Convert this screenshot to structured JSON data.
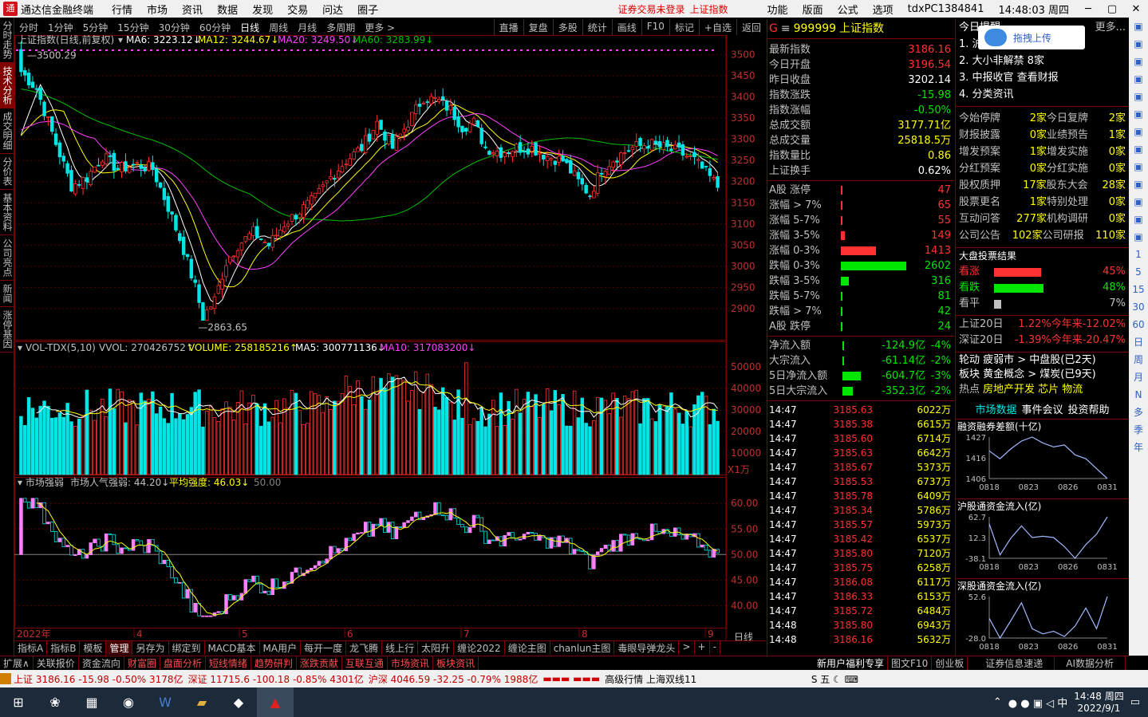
{
  "title_bar": {
    "app_name": "通达信金融终端",
    "menus": [
      "行情",
      "市场",
      "资讯",
      "数据",
      "发现",
      "交易",
      "问达",
      "圈子"
    ],
    "notice_login": "证券交易未登录",
    "notice_market": "上证指数",
    "right_menus": [
      "功能",
      "版面",
      "公式",
      "选项"
    ],
    "user": "tdxPC1384841",
    "time": "14:48:03 周四"
  },
  "left_tabs": [
    "分时走势",
    "技术分析",
    "成交明细",
    "分价表",
    "基本资料",
    "公司亮点",
    "新闻",
    "涨停基因"
  ],
  "chart_toolbar": {
    "periods": [
      "分时",
      "1分钟",
      "5分钟",
      "15分钟",
      "30分钟",
      "60分钟",
      "日线",
      "周线",
      "月线",
      "多周期",
      "更多 >"
    ],
    "active_period": "日线",
    "tools": [
      "直播",
      "复盘",
      "多股",
      "统计",
      "画线",
      "F10",
      "标记",
      "+自选",
      "返回"
    ]
  },
  "kline_header": {
    "name": "上证指数(日线,前复权)",
    "ma6": "MA6: 3223.12↓",
    "ma12": "MA12: 3244.67↓",
    "ma20": "MA20: 3249.50↓",
    "ma60": "MA60: 3283.99↓",
    "high_label": "3500.29",
    "low_label": "2863.65"
  },
  "vol_header": {
    "name": "VOL-TDX(5,10)",
    "vvol": "VVOL: 270426752↑",
    "volume": "VOLUME: 258185216↑",
    "ma5": "MA5: 300771136↓",
    "ma10": "MA10: 317083200↓",
    "unit": "X1万"
  },
  "sent_header": {
    "name": "市场强弱",
    "pop": "市场人气强弱: 44.20↓",
    "avg": "平均强度: 46.03↓",
    "ref": "50.00"
  },
  "axis": {
    "price_ticks": [
      "3500",
      "3450",
      "3400",
      "3350",
      "3300",
      "3250",
      "3200",
      "3150",
      "3100",
      "3050",
      "3000",
      "2950",
      "2900"
    ],
    "vol_ticks": [
      "50000",
      "40000",
      "30000",
      "20000",
      "10000"
    ],
    "sent_ticks": [
      "60.00",
      "55.00",
      "50.00",
      "45.00",
      "40.00"
    ],
    "x_labels": [
      "2022年",
      "4",
      "5",
      "6",
      "7",
      "8",
      "9"
    ],
    "period_label": "日线"
  },
  "colors": {
    "up": "#ff3232",
    "down": "#00e5e5",
    "ma6": "#ffffff",
    "ma12": "#ffff00",
    "ma20": "#ff40ff",
    "ma60": "#00c000",
    "frame": "#800000"
  },
  "bottom_tabs": [
    "指标A",
    "指标B",
    "模板",
    "管理",
    "另存为",
    "绑定到",
    "MACD基本",
    "MA用户",
    "每开一度",
    "龙飞腾",
    "线上行",
    "太阳升",
    "缠论2022",
    "缠论主图",
    "chanlun主图",
    "毒眼导弹龙头",
    ">",
    "+",
    "-"
  ],
  "bar2": [
    "扩展∧",
    "关联报价",
    "资金流向",
    "财富圈",
    "盘面分析",
    "短线情绪",
    "趋势研判",
    "涨跌贡献",
    "互联互通",
    "市场资讯",
    "板块资讯",
    "新用户福利专享",
    "图文F10",
    "创业板"
  ],
  "quote_panel": {
    "code": "999999",
    "name": "上证指数",
    "rows": [
      {
        "label": "最新指数",
        "value": "3186.16",
        "c": "red"
      },
      {
        "label": "今日开盘",
        "value": "3196.54",
        "c": "red"
      },
      {
        "label": "昨日收盘",
        "value": "3202.14",
        "c": "white"
      },
      {
        "label": "指数涨跌",
        "value": "-15.98",
        "c": "green"
      },
      {
        "label": "指数涨幅",
        "value": "-0.50%",
        "c": "green"
      },
      {
        "label": "总成交额",
        "value": "3177.71亿",
        "c": "yellow"
      },
      {
        "label": "总成交量",
        "value": "25818.5万",
        "c": "yellow"
      },
      {
        "label": "指数量比",
        "value": "0.86",
        "c": "yellow"
      },
      {
        "label": "上证换手",
        "value": "0.62%",
        "c": "white"
      }
    ],
    "breadth": [
      {
        "label": "A股 涨停",
        "value": "47",
        "c": "red",
        "bar": 0.02
      },
      {
        "label": "涨幅 > 7%",
        "value": "65",
        "c": "red",
        "bar": 0.03
      },
      {
        "label": "涨幅 5-7%",
        "value": "55",
        "c": "red",
        "bar": 0.02
      },
      {
        "label": "涨幅 3-5%",
        "value": "149",
        "c": "red",
        "bar": 0.06
      },
      {
        "label": "涨幅 0-3%",
        "value": "1413",
        "c": "red",
        "bar": 0.54
      },
      {
        "label": "跌幅 0-3%",
        "value": "2602",
        "c": "green",
        "bar": 1.0
      },
      {
        "label": "跌幅 3-5%",
        "value": "316",
        "c": "green",
        "bar": 0.12
      },
      {
        "label": "跌幅 5-7%",
        "value": "81",
        "c": "green",
        "bar": 0.03
      },
      {
        "label": "跌幅 > 7%",
        "value": "42",
        "c": "green",
        "bar": 0.02
      },
      {
        "label": "A股 跌停",
        "value": "24",
        "c": "green",
        "bar": 0.01
      }
    ],
    "flows": [
      {
        "label": "净流入额",
        "value": "-124.9亿",
        "pct": "-4%",
        "bar": 0.05
      },
      {
        "label": "大宗流入",
        "value": "-61.14亿",
        "pct": "-2%",
        "bar": 0.03
      },
      {
        "label": "5日净流入额",
        "value": "-604.7亿",
        "pct": "-3%",
        "bar": 0.9
      },
      {
        "label": "5日大宗流入",
        "value": "-352.3亿",
        "pct": "-2%",
        "bar": 0.5
      }
    ],
    "ticks": [
      [
        "14:47",
        "3185.63",
        "6022万"
      ],
      [
        "14:47",
        "3185.38",
        "6615万"
      ],
      [
        "14:47",
        "3185.60",
        "6714万"
      ],
      [
        "14:47",
        "3185.63",
        "6642万"
      ],
      [
        "14:47",
        "3185.67",
        "5373万"
      ],
      [
        "14:47",
        "3185.53",
        "6737万"
      ],
      [
        "14:47",
        "3185.78",
        "6409万"
      ],
      [
        "14:47",
        "3185.34",
        "5786万"
      ],
      [
        "14:47",
        "3185.57",
        "5973万"
      ],
      [
        "14:47",
        "3185.42",
        "6537万"
      ],
      [
        "14:47",
        "3185.80",
        "7120万"
      ],
      [
        "14:47",
        "3185.75",
        "6258万"
      ],
      [
        "14:47",
        "3186.08",
        "6117万"
      ],
      [
        "14:47",
        "3186.33",
        "6153万"
      ],
      [
        "14:47",
        "3185.72",
        "6484万"
      ],
      [
        "14:48",
        "3185.80",
        "6943万"
      ],
      [
        "14:48",
        "3186.16",
        "5632万"
      ]
    ]
  },
  "right_panel": {
    "header": "今日提醒",
    "more": "更多...",
    "upload_btn": "拖拽上传",
    "items": [
      "1. 沪",
      "2. 大小非解禁 8家",
      "3. 中报收官 查看财报",
      "4. 分类资讯"
    ],
    "stats": [
      [
        "今始停牌",
        "2家",
        "今日复牌",
        "2家"
      ],
      [
        "财报披露",
        "0家",
        "业绩预告",
        "1家"
      ],
      [
        "增发预案",
        "1家",
        "增发实施",
        "0家"
      ],
      [
        "分红预案",
        "0家",
        "分红实施",
        "0家"
      ],
      [
        "股权质押",
        "17家",
        "股东大会",
        "28家"
      ],
      [
        "股票更名",
        "1家",
        "特别处理",
        "0家"
      ],
      [
        "互动问答",
        "277家",
        "机构调研",
        "0家"
      ],
      [
        "公司公告",
        "102家",
        "公司研报",
        "110家"
      ]
    ],
    "vote_title": "大盘投票结果",
    "votes": [
      {
        "label": "看涨",
        "pct": "45%",
        "v": 0.45,
        "c": "#ff3232"
      },
      {
        "label": "看跌",
        "pct": "48%",
        "v": 0.48,
        "c": "#00e600"
      },
      {
        "label": "看平",
        "pct": "7%",
        "v": 0.07,
        "c": "#c0c0c0"
      }
    ],
    "sh20": "上证20日",
    "sh20v": "1.22%",
    "shytd": "今年来-12.02%",
    "sz20": "深证20日",
    "sz20v": "-1.39%",
    "szytd": "今年来-20.47%",
    "rotation": "轮动 疲弱市 > 中盘股(已2天)",
    "sector": "板块 黄金概念 > 煤炭(已9天)",
    "hot_label": "热点",
    "hot": "房地产开发 芯片 物流",
    "tabs": [
      "市场数据",
      "事件会议",
      "投资帮助"
    ],
    "charts": [
      {
        "title": "融资融券差额(十亿)",
        "y": [
          "1427",
          "1416",
          "1406"
        ],
        "x": [
          "0818",
          "0823",
          "0826",
          "0831"
        ],
        "values": [
          1420,
          1416,
          1421,
          1425,
          1427,
          1424,
          1422,
          1423,
          1418,
          1416,
          1411,
          1406
        ]
      },
      {
        "title": "沪股通资金流入(亿)",
        "y": [
          "62.7",
          "12.3",
          "-38.1"
        ],
        "x": [
          "0818",
          "0823",
          "0826",
          "0831"
        ],
        "values": [
          45,
          -30,
          10,
          40,
          12,
          15,
          12,
          -10,
          -38,
          -5,
          20,
          62
        ]
      },
      {
        "title": "深股通资金流入(亿)",
        "y": [
          "52.6",
          "",
          "-28.0"
        ],
        "x": [
          "0818",
          "0823",
          "0826",
          "0831"
        ],
        "values": [
          10,
          -28,
          5,
          40,
          -10,
          -20,
          -15,
          -25,
          -5,
          30,
          -10,
          52
        ]
      }
    ],
    "bottom_tabs": [
      "证券信息速递",
      "AI数据分析"
    ]
  },
  "status_bar": {
    "sh": "上证 3186.16 -15.98 -0.50% 3178亿",
    "sz": "深证 11715.6 -100.18 -0.85% 4301亿",
    "hs": "沪深 4046.59 -32.25 -0.79% 1988亿",
    "adv": "高级行情 上海双线11"
  },
  "taskbar": {
    "clock": "14:48 周四",
    "date": "2022/9/1"
  },
  "side_icons": [
    "1",
    "5",
    "15",
    "30",
    "60",
    "日",
    "周",
    "月",
    "N",
    "多",
    "季",
    "年"
  ]
}
